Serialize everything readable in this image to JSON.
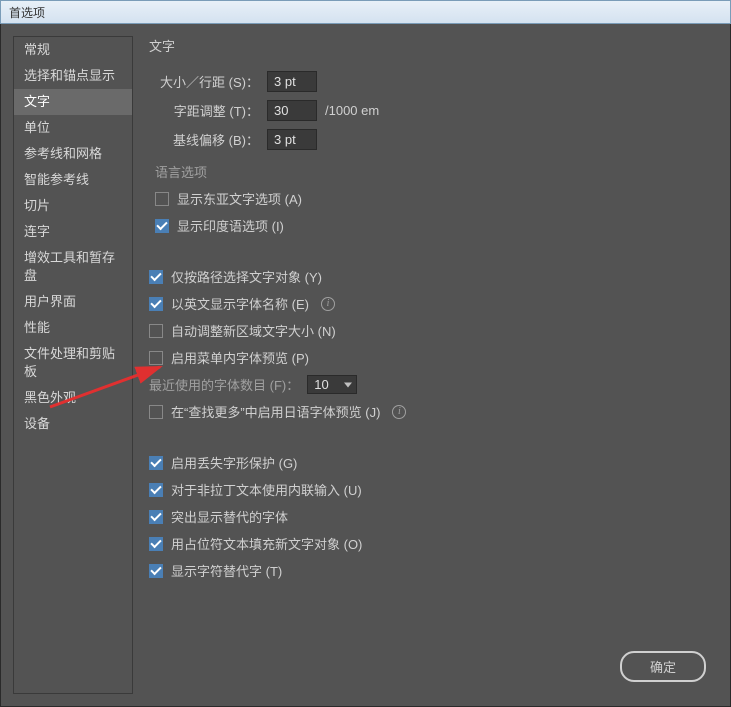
{
  "window": {
    "title": "首选项"
  },
  "sidebar": {
    "items": [
      {
        "label": "常规"
      },
      {
        "label": "选择和锚点显示"
      },
      {
        "label": "文字"
      },
      {
        "label": "单位"
      },
      {
        "label": "参考线和网格"
      },
      {
        "label": "智能参考线"
      },
      {
        "label": "切片"
      },
      {
        "label": "连字"
      },
      {
        "label": "增效工具和暂存盘"
      },
      {
        "label": "用户界面"
      },
      {
        "label": "性能"
      },
      {
        "label": "文件处理和剪贴板"
      },
      {
        "label": "黑色外观"
      },
      {
        "label": "设备"
      }
    ],
    "active_index": 2
  },
  "content": {
    "title": "文字",
    "fields": {
      "size_leading_label": "大小／行距 (S)：",
      "size_leading_value": "3 pt",
      "tracking_label": "字距调整 (T)：",
      "tracking_value": "30",
      "tracking_unit": "/1000 em",
      "baseline_label": "基线偏移 (B)：",
      "baseline_value": "3 pt"
    },
    "language_group": "语言选项",
    "checkboxes": {
      "east_asian": {
        "label": "显示东亚文字选项 (A)",
        "checked": false
      },
      "indic": {
        "label": "显示印度语选项 (I)",
        "checked": true
      },
      "path_only": {
        "label": "仅按路径选择文字对象 (Y)",
        "checked": true
      },
      "english_font": {
        "label": "以英文显示字体名称 (E)",
        "checked": true,
        "info": true
      },
      "auto_size": {
        "label": "自动调整新区域文字大小 (N)",
        "checked": false
      },
      "menu_preview": {
        "label": "启用菜单内字体预览 (P)",
        "checked": false
      },
      "jp_preview": {
        "label": "在“查找更多”中启用日语字体预览 (J)",
        "checked": false,
        "info": true
      },
      "missing_glyph": {
        "label": "启用丢失字形保护 (G)",
        "checked": true
      },
      "inline_input": {
        "label": "对于非拉丁文本使用内联输入 (U)",
        "checked": true
      },
      "highlight_sub": {
        "label": "突出显示替代的字体",
        "checked": true
      },
      "placeholder_fill": {
        "label": "用占位符文本填充新文字对象 (O)",
        "checked": true
      },
      "show_alt": {
        "label": "显示字符替代字 (T)",
        "checked": true
      }
    },
    "recent_fonts_label": "最近使用的字体数目 (F)：",
    "recent_fonts_value": "10"
  },
  "buttons": {
    "ok": "确定"
  }
}
